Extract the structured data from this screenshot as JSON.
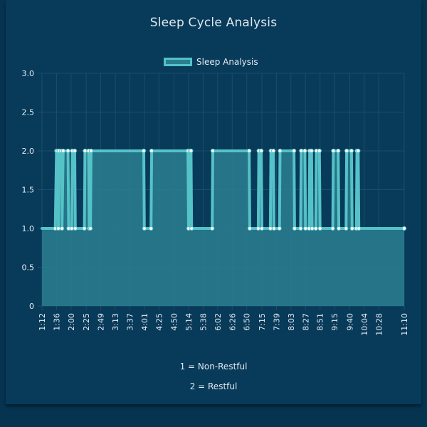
{
  "chart_data": {
    "type": "line",
    "title": "Sleep Cycle Analysis",
    "series": [
      {
        "name": "Sleep Analysis",
        "points": [
          [
            "1:12",
            1
          ],
          [
            "1:34",
            1
          ],
          [
            "1:36",
            2
          ],
          [
            "1:38",
            2
          ],
          [
            "1:39",
            1
          ],
          [
            "1:40",
            2
          ],
          [
            "1:44",
            2
          ],
          [
            "1:45",
            1
          ],
          [
            "1:47",
            2
          ],
          [
            "1:55",
            2
          ],
          [
            "1:56",
            1
          ],
          [
            "2:01",
            1
          ],
          [
            "2:02",
            2
          ],
          [
            "2:06",
            2
          ],
          [
            "2:07",
            1
          ],
          [
            "2:22",
            1
          ],
          [
            "2:23",
            2
          ],
          [
            "2:29",
            2
          ],
          [
            "2:30",
            1
          ],
          [
            "2:32",
            1
          ],
          [
            "2:33",
            2
          ],
          [
            "4:00",
            2
          ],
          [
            "4:01",
            1
          ],
          [
            "4:12",
            1
          ],
          [
            "4:13",
            2
          ],
          [
            "5:13",
            2
          ],
          [
            "5:14",
            1
          ],
          [
            "5:16",
            2
          ],
          [
            "5:18",
            2
          ],
          [
            "5:19",
            1
          ],
          [
            "5:53",
            1
          ],
          [
            "5:54",
            2
          ],
          [
            "6:54",
            2
          ],
          [
            "6:55",
            1
          ],
          [
            "7:09",
            1
          ],
          [
            "7:10",
            2
          ],
          [
            "7:14",
            2
          ],
          [
            "7:15",
            1
          ],
          [
            "7:29",
            1
          ],
          [
            "7:30",
            2
          ],
          [
            "7:34",
            2
          ],
          [
            "7:35",
            1
          ],
          [
            "7:44",
            1
          ],
          [
            "7:45",
            2
          ],
          [
            "8:08",
            2
          ],
          [
            "8:09",
            1
          ],
          [
            "8:19",
            1
          ],
          [
            "8:20",
            2
          ],
          [
            "8:26",
            2
          ],
          [
            "8:27",
            1
          ],
          [
            "8:33",
            1
          ],
          [
            "8:34",
            2
          ],
          [
            "8:37",
            2
          ],
          [
            "8:38",
            1
          ],
          [
            "8:44",
            1
          ],
          [
            "8:45",
            2
          ],
          [
            "8:50",
            2
          ],
          [
            "8:51",
            1
          ],
          [
            "9:12",
            1
          ],
          [
            "9:13",
            2
          ],
          [
            "9:21",
            2
          ],
          [
            "9:22",
            1
          ],
          [
            "9:34",
            1
          ],
          [
            "9:35",
            2
          ],
          [
            "9:43",
            2
          ],
          [
            "9:44",
            1
          ],
          [
            "9:51",
            1
          ],
          [
            "9:52",
            2
          ],
          [
            "9:54",
            2
          ],
          [
            "9:55",
            1
          ],
          [
            "11:10",
            1
          ]
        ]
      }
    ],
    "x_ticks": [
      "1:12",
      "1:36",
      "2:00",
      "2:25",
      "2:49",
      "3:13",
      "3:37",
      "4:01",
      "4:25",
      "4:50",
      "5:14",
      "5:38",
      "6:02",
      "6:26",
      "6:50",
      "7:15",
      "7:39",
      "8:03",
      "8:27",
      "8:51",
      "9:15",
      "9:40",
      "10:04",
      "10:28",
      "11:10"
    ],
    "y_ticks": [
      "0",
      "0.5",
      "1.0",
      "1.5",
      "2.0",
      "2.5",
      "3.0"
    ],
    "ylim": [
      0,
      3
    ],
    "grid": true,
    "legend": "top",
    "colors": {
      "line": "#55c2c8",
      "fill": "#2a7f8f",
      "point": "#ffffff",
      "grid": "#1d4d6a",
      "text": "#e6eef2"
    }
  },
  "notes": [
    "1 = Non-Restful",
    "2 = Restful"
  ]
}
